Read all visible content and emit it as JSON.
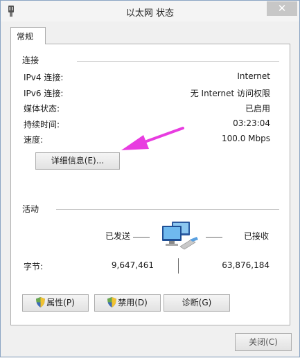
{
  "window": {
    "title": "以太网 状态",
    "close_symbol": "✕"
  },
  "tab": {
    "label": "常规"
  },
  "connection": {
    "heading": "连接",
    "rows": [
      {
        "label": "IPv4 连接:",
        "value": "Internet"
      },
      {
        "label": "IPv6 连接:",
        "value": "无 Internet 访问权限"
      },
      {
        "label": "媒体状态:",
        "value": "已启用"
      },
      {
        "label": "持续时间:",
        "value": "03:23:04"
      },
      {
        "label": "速度:",
        "value": "100.0 Mbps"
      }
    ],
    "details_button": "详细信息(E)..."
  },
  "activity": {
    "heading": "活动",
    "sent_label": "已发送",
    "received_label": "已接收",
    "bytes_label": "字节:",
    "bytes_sent": "9,647,461",
    "bytes_received": "63,876,184"
  },
  "buttons": {
    "properties": "属性(P)",
    "disable": "禁用(D)",
    "diagnose": "诊断(G)"
  },
  "footer": {
    "close_label": "关闭(C)"
  },
  "colors": {
    "annotation_arrow": "#e83ce0",
    "window_border": "#8aa4c3"
  },
  "icons": [
    "network-adapter-icon",
    "monitors-network-icon",
    "uac-shield-icon",
    "close-icon"
  ]
}
